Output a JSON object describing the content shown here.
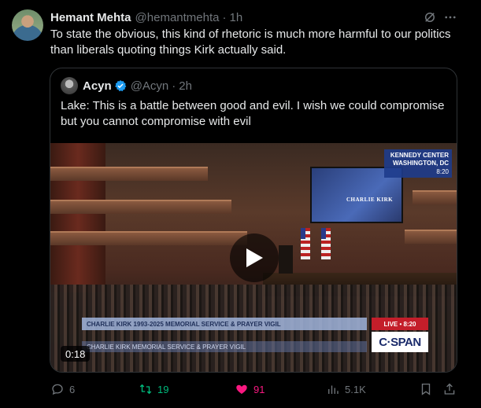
{
  "author": {
    "name": "Hemant Mehta",
    "handle": "@hemantmehta",
    "separator": "·",
    "time": "1h"
  },
  "tweet_text": "To state the obvious, this kind of rhetoric is much more harmful to our politics than liberals quoting things Kirk actually said.",
  "quote": {
    "name": "Acyn",
    "handle": "@Acyn",
    "separator": "·",
    "time": "2h",
    "text": "Lake: This is a battle between good and evil. I wish we could compromise but you cannot compromise with evil"
  },
  "video": {
    "duration": "0:18",
    "location_line1": "KENNEDY CENTER",
    "location_line2": "WASHINGTON, DC",
    "clock": "8:20",
    "screen_text": "CHARLIE KIRK",
    "lower_third": "CHARLIE KIRK   1993-2025   MEMORIAL SERVICE & PRAYER VIGIL",
    "lower_third_2": "CHARLIE KIRK  MEMORIAL SERVICE & PRAYER VIGIL",
    "live_label": "LIVE • 8:20",
    "network": "C·SPAN"
  },
  "actions": {
    "replies": "6",
    "reposts": "19",
    "likes": "91",
    "views": "5.1K"
  },
  "colors": {
    "repost_active": "#00ba7c",
    "like_active": "#f91880",
    "verified": "#1d9bf0",
    "muted": "#71767b"
  }
}
